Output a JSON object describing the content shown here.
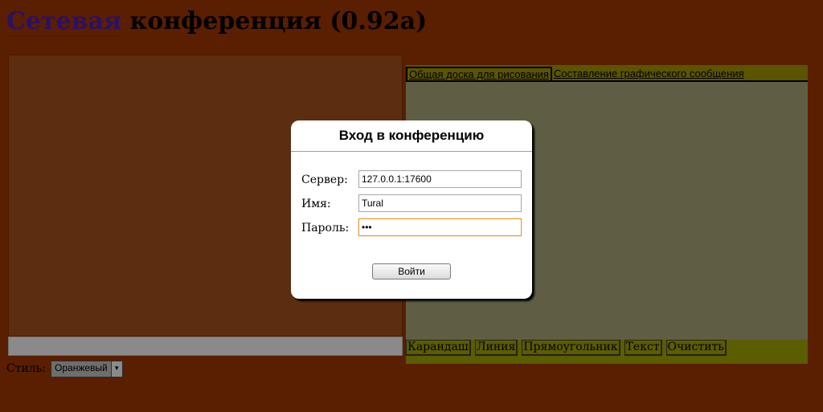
{
  "page": {
    "title_link": "Сетевая",
    "title_rest": " конференция (0.92а)"
  },
  "style_selector": {
    "label": "Стиль:",
    "selected": "Оранжевый"
  },
  "whiteboard": {
    "tabs": [
      {
        "label": "Общая доска для рисования",
        "active": true
      },
      {
        "label": "Составление графического сообщения",
        "active": false
      }
    ],
    "tools": [
      "Карандаш",
      "Линия",
      "Прямоугольник",
      "Текст",
      "Очистить"
    ]
  },
  "login_dialog": {
    "title": "Вход в конференцию",
    "server_label": "Сервер:",
    "server_value": "127.0.0.1:17600",
    "name_label": "Имя:",
    "name_value": "Tural",
    "password_label": "Пароль:",
    "password_value": "•••",
    "login_button": "Войти"
  },
  "colors": {
    "background": "#5a1e00",
    "chat_panel": "#5d2d10",
    "whiteboard": "#5f5e44",
    "toolbar": "#5c5c00",
    "focus_border": "#e39a32"
  }
}
